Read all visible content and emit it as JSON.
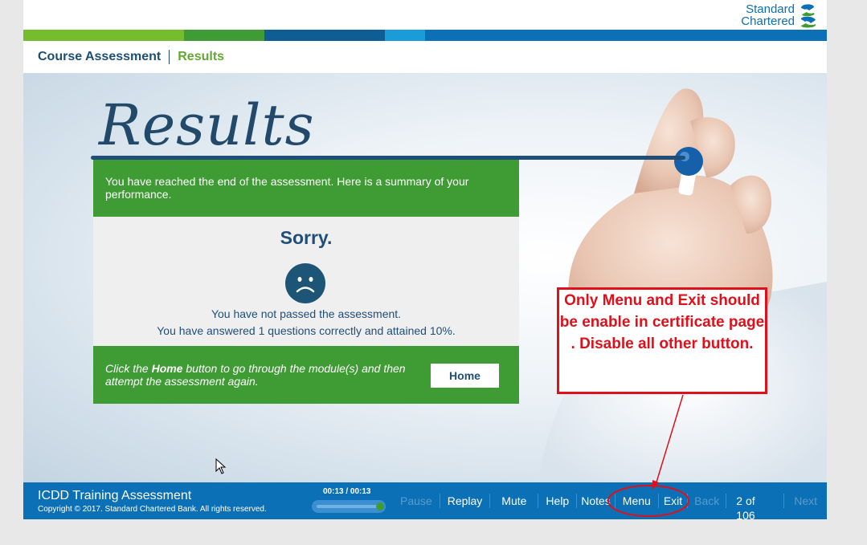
{
  "logo": {
    "line1": "Standard",
    "line2": "Chartered"
  },
  "colors": {
    "stripe": [
      "#75bd2f",
      "#3f9b34",
      "#0f5d95",
      "#1b9bd7",
      "#0b70b6"
    ],
    "green": "#3f9b34",
    "blue": "#0b70b6",
    "annotation": "#e0101b"
  },
  "breadcrumb": {
    "course": "Course Assessment",
    "current": "Results"
  },
  "stage": {
    "title": "Results",
    "summary": "You have reached the end of the assessment. Here is a summary of your performance.",
    "verdict": "Sorry.",
    "face_icon": "sad-face-icon",
    "not_passed": "You have not passed the assessment.",
    "answered": "You have answered 1 questions correctly and attained 10%.",
    "instruction_pre": "Click the ",
    "instruction_bold": "Home",
    "instruction_post": " button to go through the module(s) and then attempt the assessment again.",
    "home_label": "Home"
  },
  "annotation": {
    "text": "Only Menu and Exit should be enable in certificate page . Disable all other button."
  },
  "footer": {
    "course_title": "ICDD Training Assessment",
    "copyright": "Copyright © 2017. Standard Chartered Bank. All rights reserved.",
    "time": "00:13 / 00:13",
    "progress": 1.0,
    "controls": {
      "pause": "Pause",
      "replay": "Replay",
      "mute": "Mute",
      "help": "Help",
      "notes": "Notes",
      "menu": "Menu",
      "exit": "Exit",
      "back": "Back",
      "page": "2 of 106",
      "next": "Next"
    }
  }
}
